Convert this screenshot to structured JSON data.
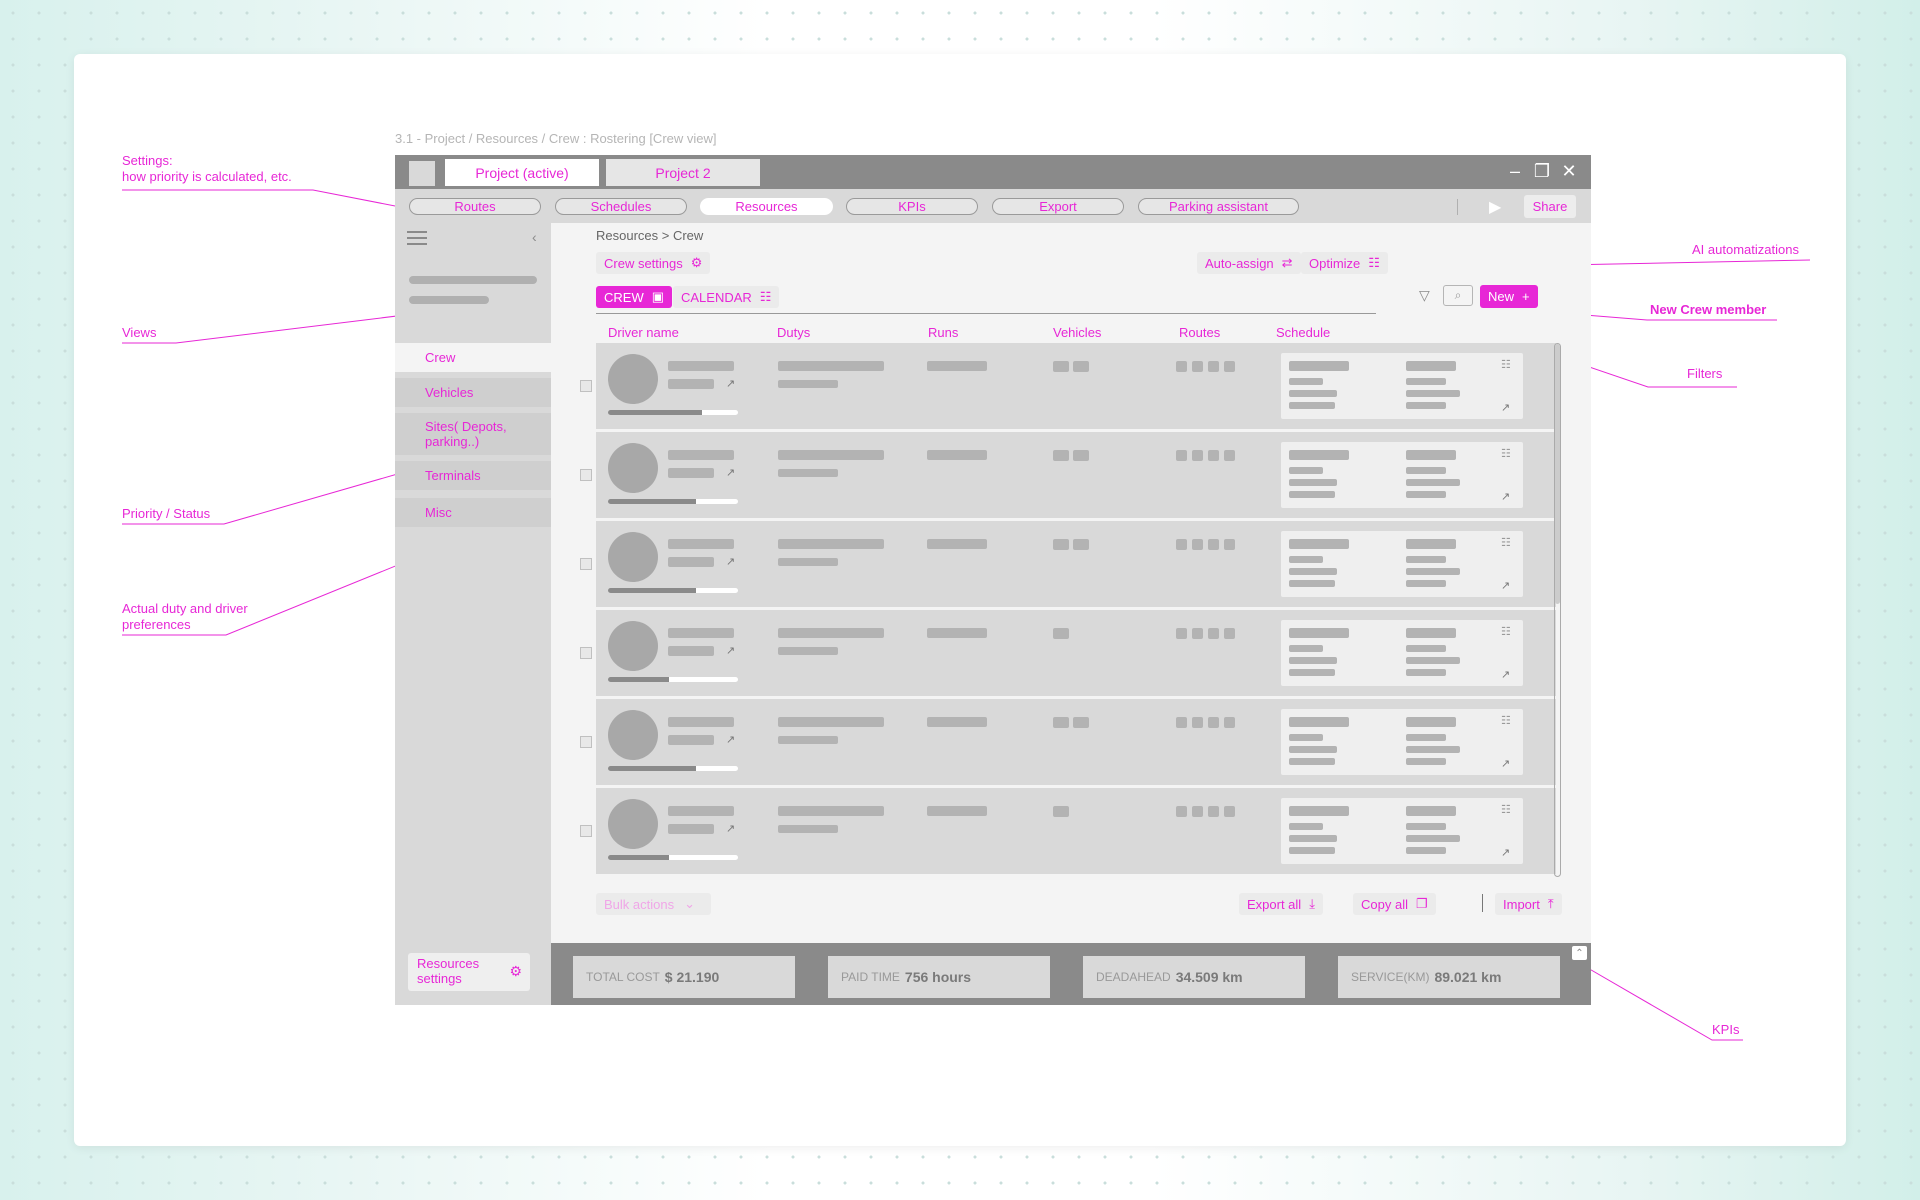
{
  "caption": "3.1 - Project / Resources / Crew : Rostering [Crew view]",
  "annotations": {
    "settings": [
      "Settings:",
      "how priority is calculated, etc."
    ],
    "views": "Views",
    "priority": "Priority / Status",
    "duty": [
      "Actual duty and driver",
      "preferences"
    ],
    "ai": "AI automatizations",
    "new_crew": "New Crew member",
    "filters": "Filters",
    "kpis": "KPIs"
  },
  "window": {
    "project_tabs": [
      {
        "label": "Project (active)",
        "active": true
      },
      {
        "label": "Project 2",
        "active": false
      }
    ],
    "controls": {
      "minimize": "minimize-icon",
      "restore": "restore-icon",
      "close": "close-icon"
    },
    "nav_tabs": [
      {
        "label": "Routes",
        "active": false
      },
      {
        "label": "Schedules",
        "active": false
      },
      {
        "label": "Resources",
        "active": true
      },
      {
        "label": "KPIs",
        "active": false
      },
      {
        "label": "Export",
        "active": false
      },
      {
        "label": "Parking assistant",
        "active": false
      }
    ],
    "share_label": "Share"
  },
  "sidebar": {
    "items": [
      {
        "label": "Crew",
        "active": true
      },
      {
        "label": "Vehicles",
        "active": false
      },
      {
        "label": "Sites( Depots, parking..)",
        "active": false
      },
      {
        "label": "Terminals",
        "active": false
      },
      {
        "label": "Misc",
        "active": false
      }
    ],
    "settings_label": [
      "Resources",
      "settings"
    ]
  },
  "main": {
    "breadcrumb": "Resources > Crew",
    "crew_settings_label": "Crew settings",
    "auto_assign_label": "Auto-assign",
    "optimize_label": "Optimize",
    "view_tabs": [
      {
        "label": "CREW",
        "active": true
      },
      {
        "label": "CALENDAR",
        "active": false
      }
    ],
    "new_label": "New",
    "columns": [
      "Driver name",
      "Dutys",
      "Runs",
      "Vehicles",
      "Routes",
      "Schedule"
    ],
    "rows": [
      {
        "priority": 0.72,
        "vehicles": 2,
        "routes": 4
      },
      {
        "priority": 0.68,
        "vehicles": 2,
        "routes": 4
      },
      {
        "priority": 0.68,
        "vehicles": 2,
        "routes": 4
      },
      {
        "priority": 0.47,
        "vehicles": 1,
        "routes": 4
      },
      {
        "priority": 0.68,
        "vehicles": 2,
        "routes": 4
      },
      {
        "priority": 0.47,
        "vehicles": 1,
        "routes": 4
      }
    ],
    "bulk_actions_label": "Bulk actions",
    "export_all_label": "Export all",
    "copy_all_label": "Copy all",
    "import_label": "Import"
  },
  "kpis": [
    {
      "label": "TOTAL COST",
      "value": "$ 21.190"
    },
    {
      "label": "PAID TIME",
      "value": "756 hours"
    },
    {
      "label": "DEADAHEAD",
      "value": "34.509 km"
    },
    {
      "label": "SERVICE(KM)",
      "value": "89.021 km"
    }
  ],
  "colors": {
    "accent": "#e727d6",
    "panel": "#d9d9d9",
    "titlebar": "#8a8a8a"
  }
}
